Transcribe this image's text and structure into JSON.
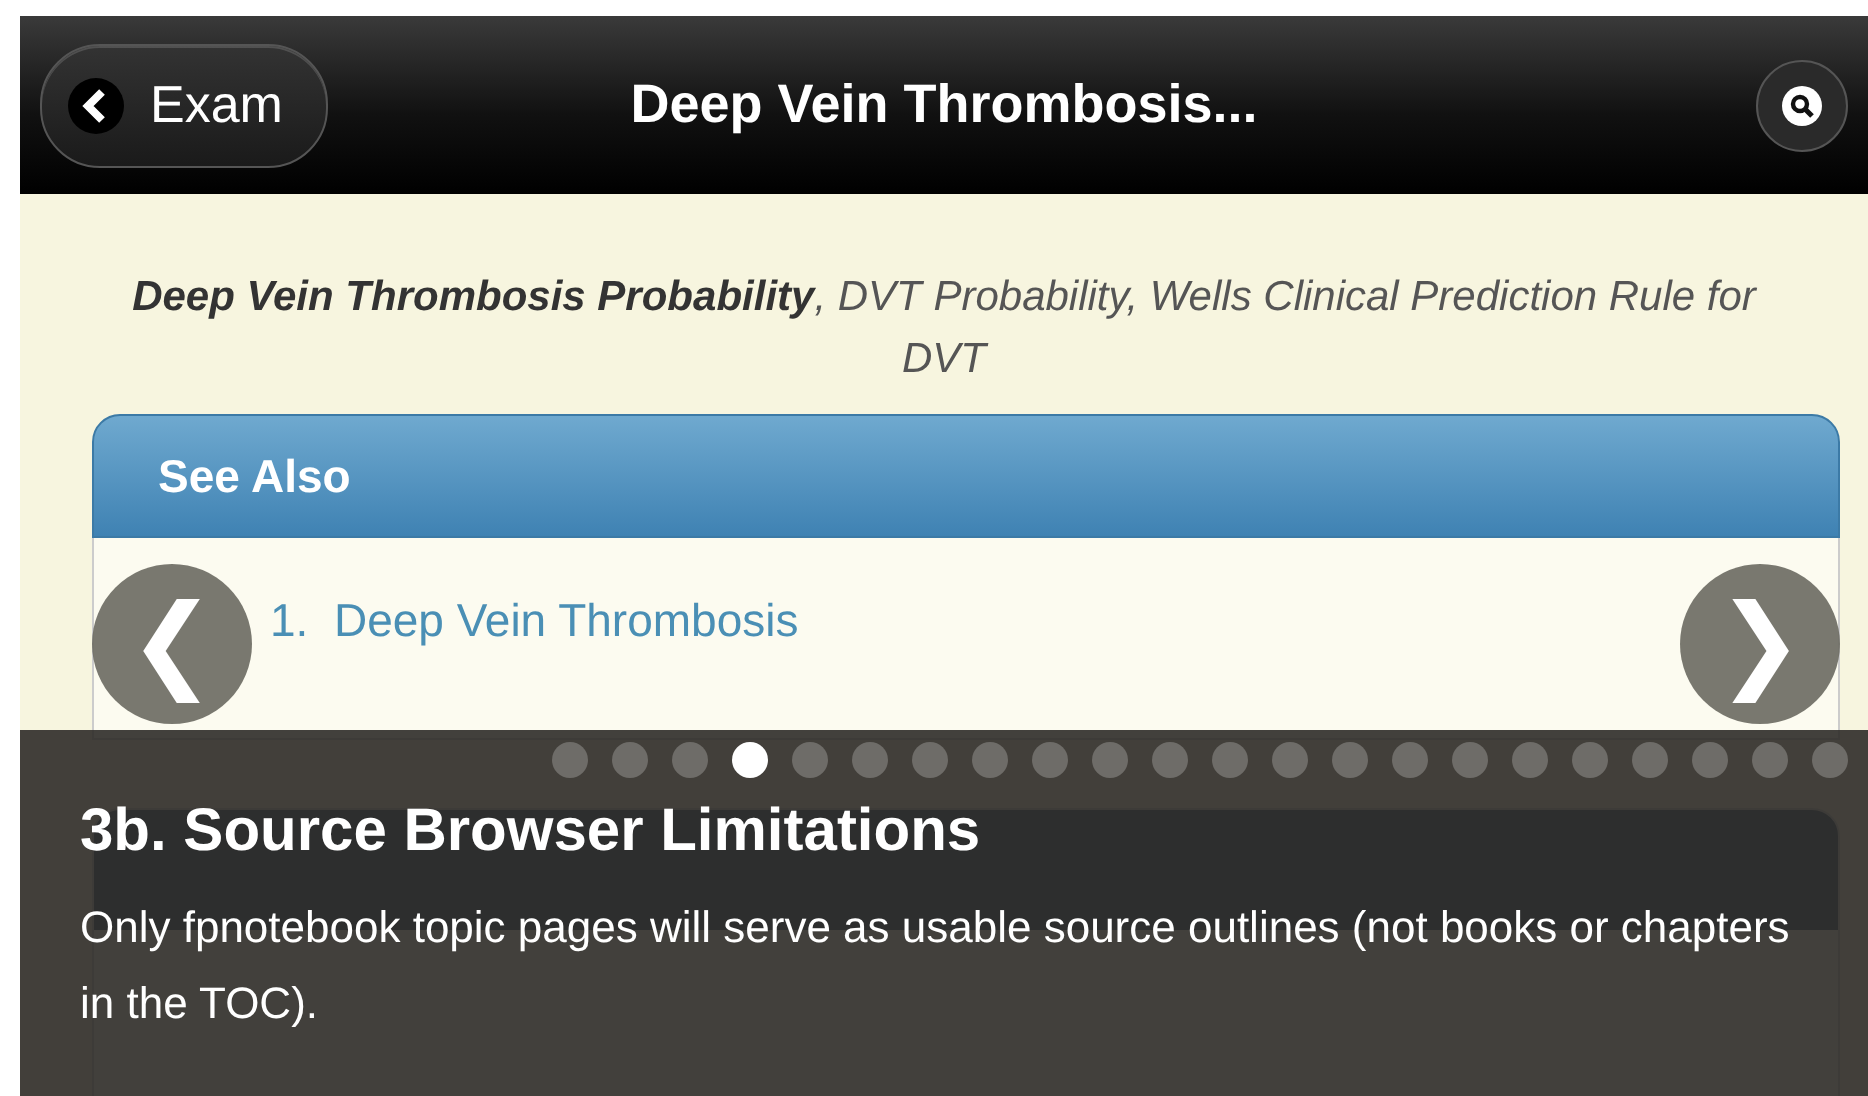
{
  "header": {
    "back_button": "Exam",
    "title": "Deep Vein Thrombosis..."
  },
  "synonyms": "**Deep Vein Thrombosis Probability**, DVT Probability, Wells Clinical Prediction Rule for DVT",
  "sections": [
    {
      "title": "See Also",
      "items": [
        {
          "number": "1.",
          "label": "Deep Vein Thrombosis",
          "kind": "link"
        }
      ]
    }
  ],
  "tour": {
    "prev": "❮",
    "next": "❯",
    "dots": [
      {
        "selected": false
      },
      {
        "selected": false
      },
      {
        "selected": false
      },
      {
        "selected": true
      },
      {
        "selected": false
      },
      {
        "selected": false
      },
      {
        "selected": false
      },
      {
        "selected": false
      },
      {
        "selected": false
      },
      {
        "selected": false
      },
      {
        "selected": false
      },
      {
        "selected": false
      },
      {
        "selected": false
      },
      {
        "selected": false
      },
      {
        "selected": false
      },
      {
        "selected": false
      },
      {
        "selected": false
      },
      {
        "selected": false
      },
      {
        "selected": false
      },
      {
        "selected": false
      },
      {
        "selected": false
      },
      {
        "selected": false
      }
    ],
    "title": "3b. Source Browser Limitations",
    "text": "Only fpnotebook topic pages will serve as usable source outlines (not books or chapters in the TOC)."
  }
}
